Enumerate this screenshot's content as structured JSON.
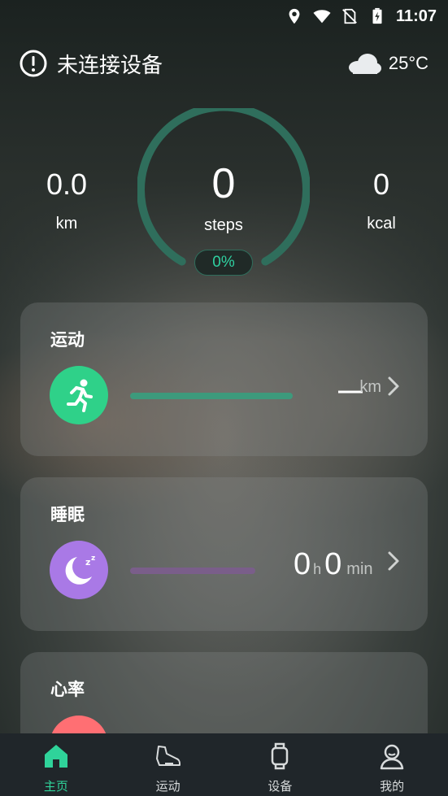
{
  "status_bar": {
    "time": "11:07"
  },
  "header": {
    "title": "未连接设备",
    "temperature": "25°C"
  },
  "stats": {
    "distance": {
      "value": "0.0",
      "unit": "km"
    },
    "steps": {
      "value": "0",
      "unit": "steps",
      "percent": "0%"
    },
    "calories": {
      "value": "0",
      "unit": "kcal"
    }
  },
  "cards": {
    "exercise": {
      "title": "运动",
      "value": "—",
      "unit": "km"
    },
    "sleep": {
      "title": "睡眠",
      "hours": "0",
      "hours_unit": "h",
      "minutes": "0",
      "minutes_unit": "min"
    },
    "heart": {
      "title": "心率"
    }
  },
  "tabs": [
    {
      "label": "主页",
      "icon": "home-icon",
      "active": true
    },
    {
      "label": "运动",
      "icon": "shoe-icon",
      "active": false
    },
    {
      "label": "设备",
      "icon": "watch-icon",
      "active": false
    },
    {
      "label": "我的",
      "icon": "profile-icon",
      "active": false
    }
  ],
  "colors": {
    "accent": "#2fd39a",
    "ring": "#2f6e5c",
    "exercise_bar": "#3d9a7c",
    "sleep_bar": "#7a5e8a",
    "exercise_icon": "#2fd189",
    "sleep_icon": "#a979e6",
    "heart_icon": "#ff6f73"
  }
}
